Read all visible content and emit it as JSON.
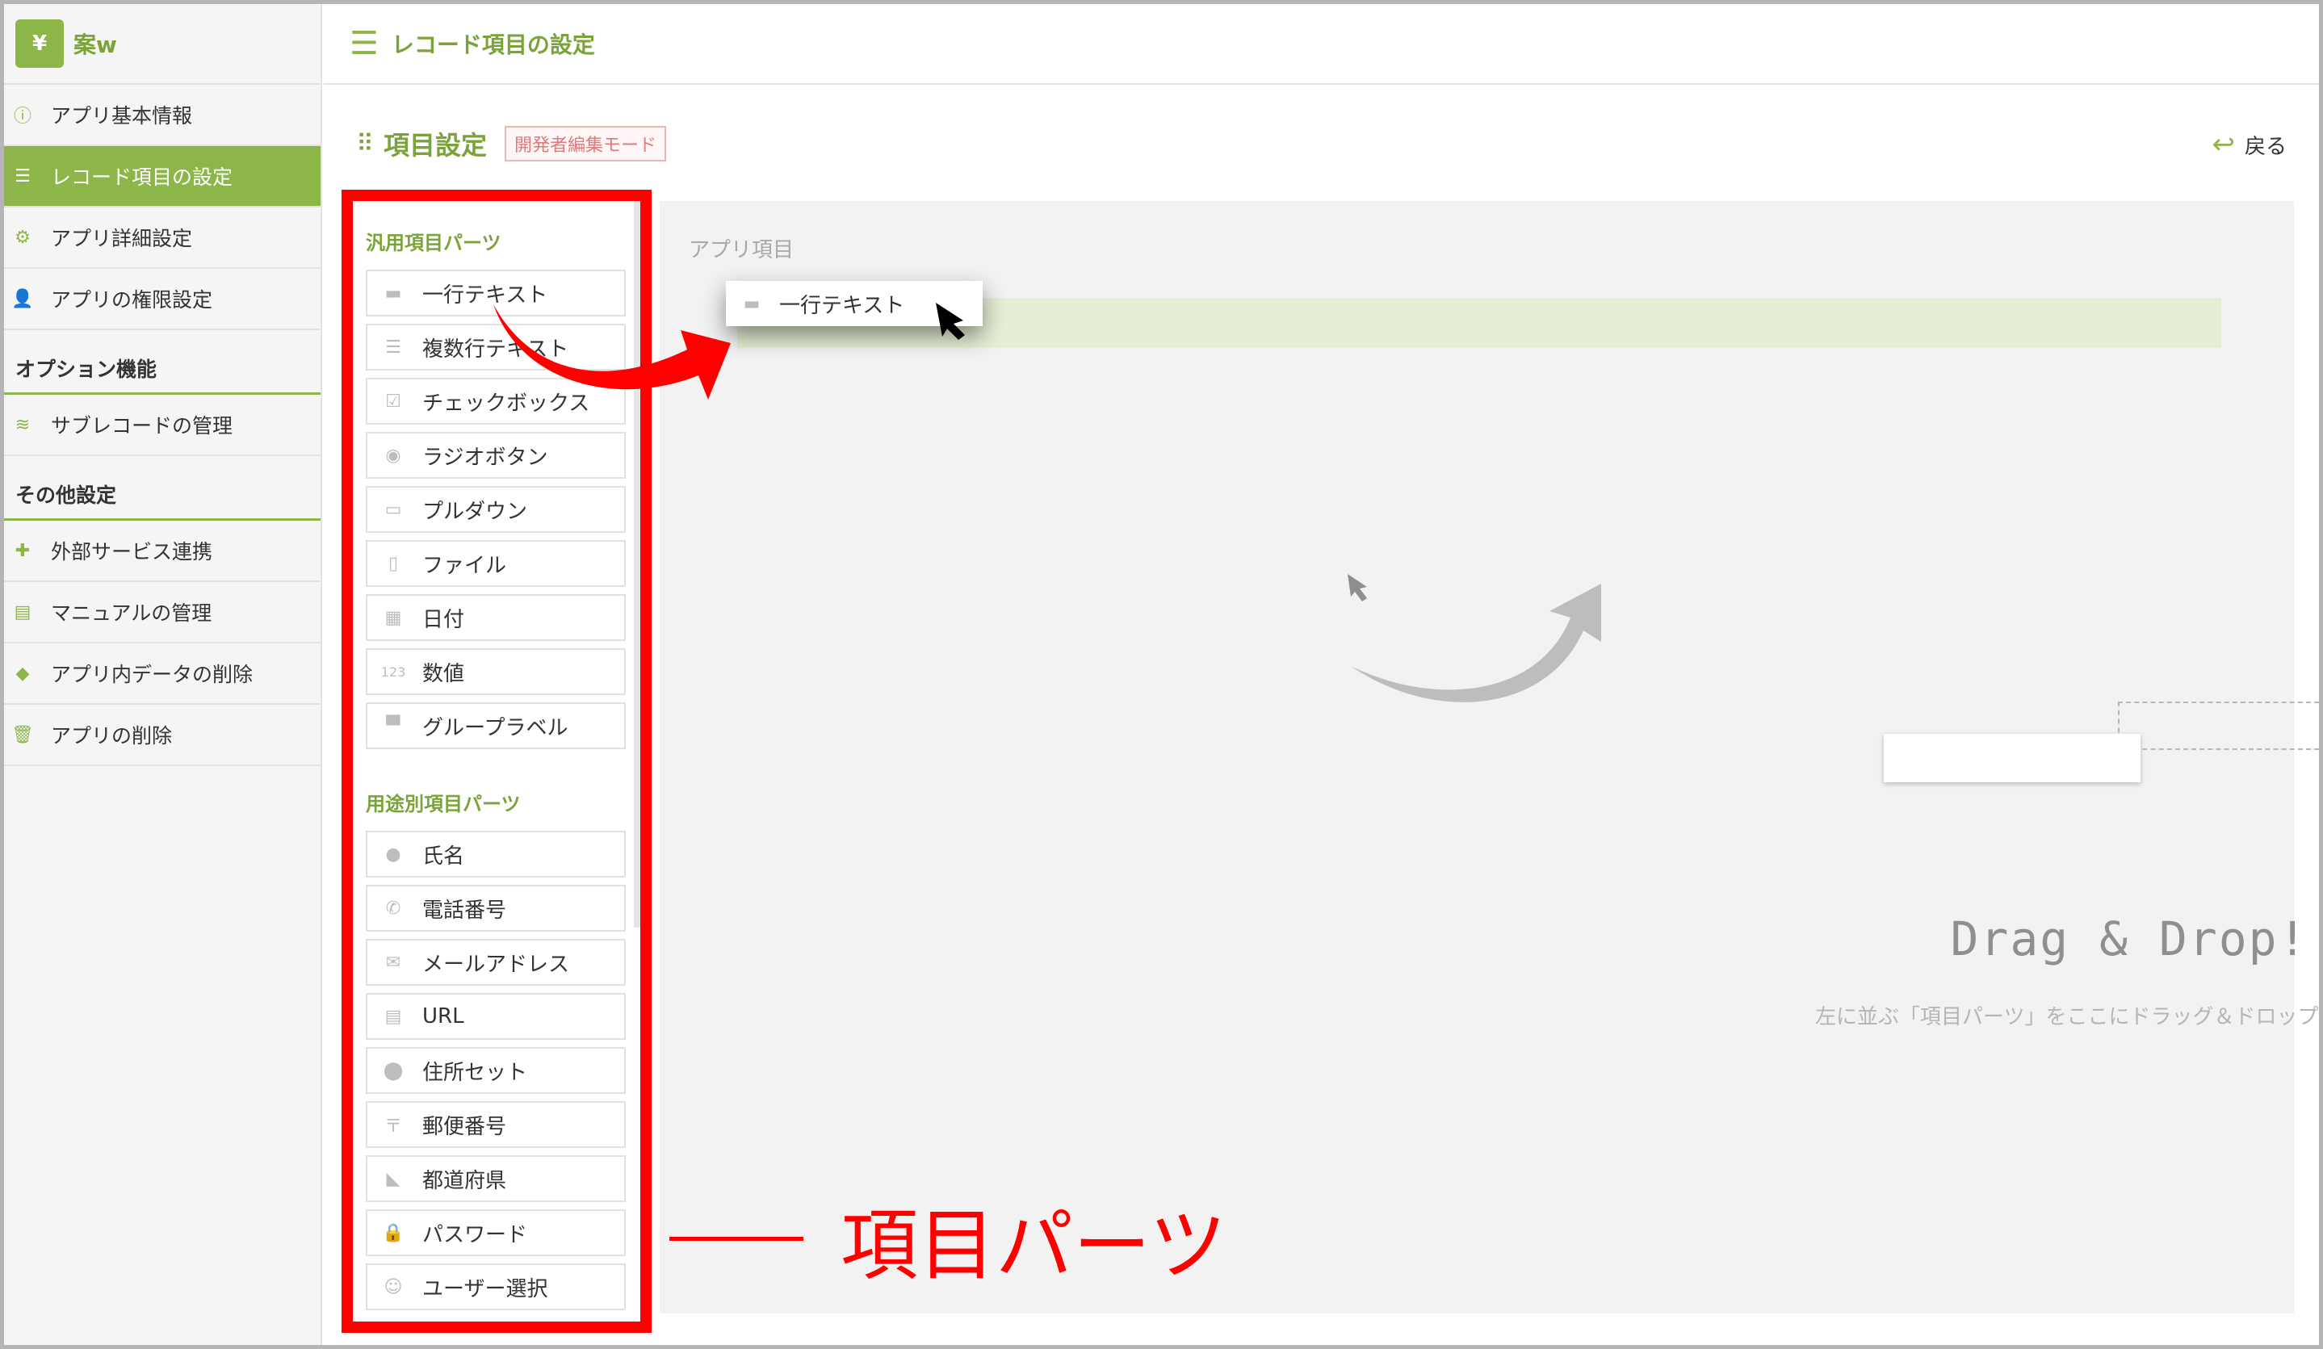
{
  "app": {
    "logo_icon": "yen-chart-icon",
    "logo_label": "案w"
  },
  "header": {
    "title": "レコード項目の設定"
  },
  "sidebar": {
    "items": [
      {
        "label": "アプリ基本情報",
        "icon": "info-icon"
      },
      {
        "label": "レコード項目の設定",
        "icon": "list-icon",
        "active": true
      },
      {
        "label": "アプリ詳細設定",
        "icon": "gear-icon"
      },
      {
        "label": "アプリの権限設定",
        "icon": "user-lock-icon"
      }
    ],
    "section_options": "オプション機能",
    "option_items": [
      {
        "label": "サブレコードの管理",
        "icon": "layers-icon"
      }
    ],
    "section_other": "その他設定",
    "other_items": [
      {
        "label": "外部サービス連携",
        "icon": "puzzle-icon"
      },
      {
        "label": "マニュアルの管理",
        "icon": "book-icon"
      },
      {
        "label": "アプリ内データの削除",
        "icon": "eraser-icon"
      },
      {
        "label": "アプリの削除",
        "icon": "trash-icon"
      }
    ]
  },
  "main": {
    "section_title": "項目設定",
    "dev_mode_badge": "開発者編集モード",
    "back_label": "戻る",
    "drop_area_label": "アプリ項目",
    "dragging_item": "一行テキスト",
    "drag_drop_title": "Drag & Drop!",
    "drag_drop_hint": "左に並ぶ「項目パーツ」をここにドラッグ＆ドロップしてください"
  },
  "parts": {
    "general_title": "汎用項目パーツ",
    "general": [
      {
        "label": "一行テキスト",
        "icon": "single-line-icon"
      },
      {
        "label": "複数行テキスト",
        "icon": "multi-line-icon"
      },
      {
        "label": "チェックボックス",
        "icon": "checkbox-icon"
      },
      {
        "label": "ラジオボタン",
        "icon": "radio-icon"
      },
      {
        "label": "プルダウン",
        "icon": "dropdown-icon"
      },
      {
        "label": "ファイル",
        "icon": "file-icon"
      },
      {
        "label": "日付",
        "icon": "calendar-icon"
      },
      {
        "label": "数値",
        "icon": "number-icon"
      },
      {
        "label": "グループラベル",
        "icon": "group-label-icon"
      }
    ],
    "purpose_title": "用途別項目パーツ",
    "purpose": [
      {
        "label": "氏名",
        "icon": "person-icon"
      },
      {
        "label": "電話番号",
        "icon": "phone-icon"
      },
      {
        "label": "メールアドレス",
        "icon": "mail-icon"
      },
      {
        "label": "URL",
        "icon": "url-icon"
      },
      {
        "label": "住所セット",
        "icon": "pin-icon"
      },
      {
        "label": "郵便番号",
        "icon": "postal-icon"
      },
      {
        "label": "都道府県",
        "icon": "map-icon"
      },
      {
        "label": "パスワード",
        "icon": "lock-icon"
      },
      {
        "label": "ユーザー選択",
        "icon": "user-select-icon"
      }
    ]
  },
  "annotation": {
    "callout_text": "項目パーツ",
    "highlight_color": "#ff0000"
  },
  "colors": {
    "accent": "#8db648",
    "accent_text": "#7aa33a"
  }
}
